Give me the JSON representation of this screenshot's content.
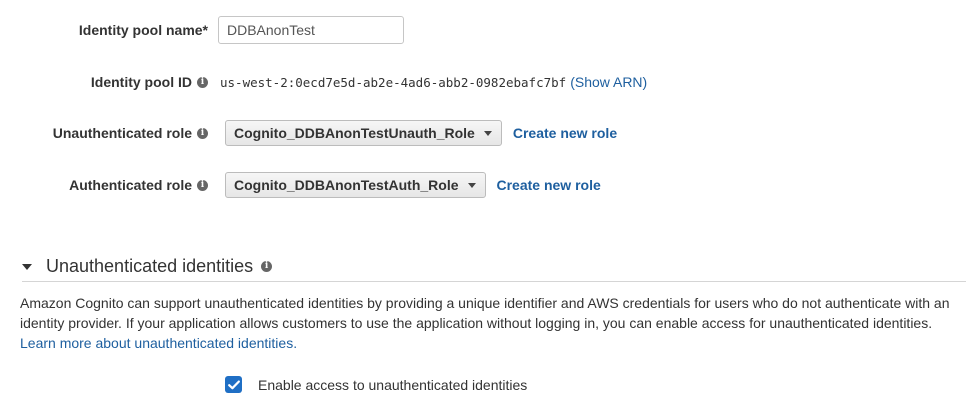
{
  "pool_name": {
    "label": "Identity pool name*",
    "value": "DDBAnonTest"
  },
  "pool_id": {
    "label": "Identity pool ID",
    "value": "us-west-2:0ecd7e5d-ab2e-4ad6-abb2-0982ebafc7bf",
    "show_arn": "(Show ARN)"
  },
  "unauth_role": {
    "label": "Unauthenticated role",
    "selected": "Cognito_DDBAnonTestUnauth_Role",
    "create_link": "Create new role"
  },
  "auth_role": {
    "label": "Authenticated role",
    "selected": "Cognito_DDBAnonTestAuth_Role",
    "create_link": "Create new role"
  },
  "unauth_section": {
    "title": "Unauthenticated identities",
    "description": "Amazon Cognito can support unauthenticated identities by providing a unique identifier and AWS credentials for users who do not authenticate with an identity provider. If your application allows customers to use the application without logging in, you can enable access for unauthenticated identities.",
    "learn_more": "Learn more about unauthenticated identities.",
    "checkbox_label": "Enable access to unauthenticated identities",
    "checkbox_checked": true
  },
  "colors": {
    "link": "#1e5f9f",
    "checkbox": "#1f6fc5"
  },
  "icons": {
    "info": "info-icon",
    "collapse": "triangle-down-icon",
    "dropdown": "caret-down-icon",
    "check": "checkmark-icon"
  }
}
